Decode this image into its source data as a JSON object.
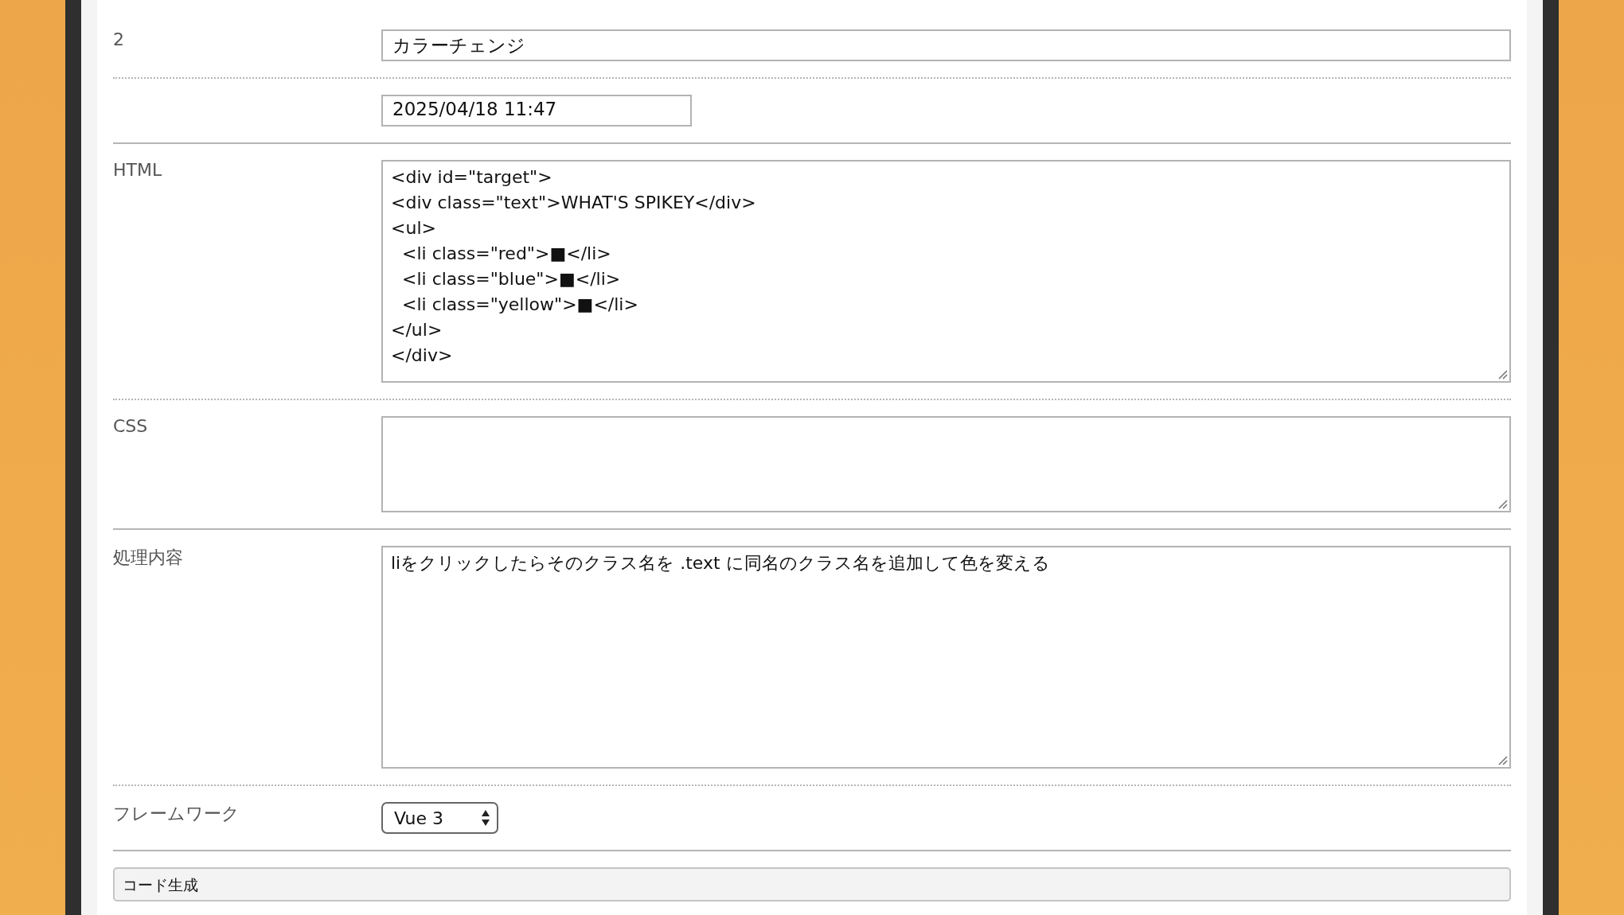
{
  "form": {
    "rows": [
      {
        "label": "2",
        "kind": "text",
        "value": "カラーチェンジ",
        "short": false,
        "dotted_rule": true
      },
      {
        "kind": "text",
        "value": "2025/04/18 11:47",
        "short": true,
        "dotted_rule": false
      },
      {
        "label": "HTML",
        "kind": "textarea",
        "tall": true,
        "value": "<div id=\"target\">\n<div class=\"text\">WHAT'S SPIKEY</div>\n<ul>\n  <li class=\"red\">■</li>\n  <li class=\"blue\">■</li>\n  <li class=\"yellow\">■</li>\n</ul>\n</div>",
        "dotted_rule": true
      },
      {
        "label": "CSS",
        "kind": "textarea",
        "tall": false,
        "dotted_rule": false
      },
      {
        "label": "処理内容",
        "kind": "textarea",
        "tall": true,
        "value": "liをクリックしたらそのクラス名を .text に同名のクラス名を追加して色を変える",
        "dotted_rule": true
      },
      {
        "label": "フレームワーク",
        "kind": "select",
        "value": "Vue 3",
        "dotted_rule": false
      }
    ]
  },
  "section": {
    "title": "コード生成"
  }
}
